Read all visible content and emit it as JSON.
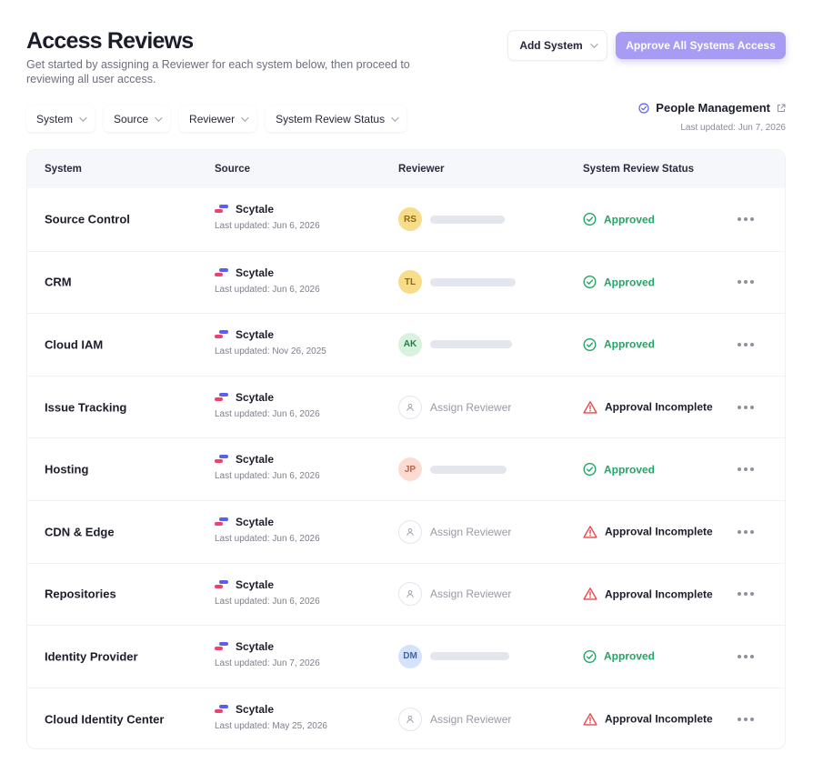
{
  "header": {
    "title": "Access Reviews",
    "subtitle": "Get started by assigning a Reviewer for each system below, then proceed to reviewing all user access.",
    "add_system_label": "Add System",
    "approve_all_label": "Approve All Systems Access"
  },
  "filters": [
    "System",
    "Source",
    "Reviewer",
    "System Review Status"
  ],
  "people_management": {
    "label": "People Management",
    "updated": "Last updated: Jun 7, 2026"
  },
  "table": {
    "columns": [
      "System",
      "Source",
      "Reviewer",
      "System Review Status"
    ],
    "rows": [
      {
        "system": "Source Control",
        "source": "Scytale",
        "updated": "Last updated: Jun 6, 2026",
        "reviewer": "RS",
        "status": "Approved"
      },
      {
        "system": "CRM",
        "source": "Scytale",
        "updated": "Last updated: Jun 6, 2026",
        "reviewer": "TL",
        "status": "Approved"
      },
      {
        "system": "Cloud IAM",
        "source": "Scytale",
        "updated": "Last updated: Nov 26, 2025",
        "reviewer": "AK",
        "status": "Approved"
      },
      {
        "system": "Issue Tracking",
        "source": "Scytale",
        "updated": "Last updated: Jun 6, 2026",
        "reviewer": "Assign Reviewer",
        "status": "Approval Incomplete"
      },
      {
        "system": "Hosting",
        "source": "Scytale",
        "updated": "Last updated: Jun 6, 2026",
        "reviewer": "JP",
        "status": "Approved"
      },
      {
        "system": "CDN & Edge",
        "source": "Scytale",
        "updated": "Last updated: Jun 6, 2026",
        "reviewer": "Assign Reviewer",
        "status": "Approval Incomplete"
      },
      {
        "system": "Repositories",
        "source": "Scytale",
        "updated": "Last updated: Jun 6, 2026",
        "reviewer": "Assign Reviewer",
        "status": "Approval Incomplete"
      },
      {
        "system": "Identity Provider",
        "source": "Scytale",
        "updated": "Last updated: Jun 7, 2026",
        "reviewer": "DM",
        "status": "Approved"
      },
      {
        "system": "Cloud Identity Center",
        "source": "Scytale",
        "updated": "Last updated: May 25, 2026",
        "reviewer": "Assign Reviewer",
        "status": "Approval Incomplete"
      }
    ]
  },
  "colors": {
    "accent": "#a79bf3",
    "approved": "#22a565",
    "warning": "#e5484d",
    "avatar_RS": "#f7dc8a",
    "avatar_TL": "#f7dc8a",
    "avatar_AK": "#d8f2df",
    "avatar_JP": "#fbdcd2",
    "avatar_DM": "#d4e2fb"
  },
  "icons": {
    "approved": "check-circle-icon",
    "incomplete": "warning-triangle-icon",
    "assign": "user-icon",
    "more": "more-horizontal-icon",
    "external": "external-link-icon",
    "people": "check-circle-icon"
  }
}
